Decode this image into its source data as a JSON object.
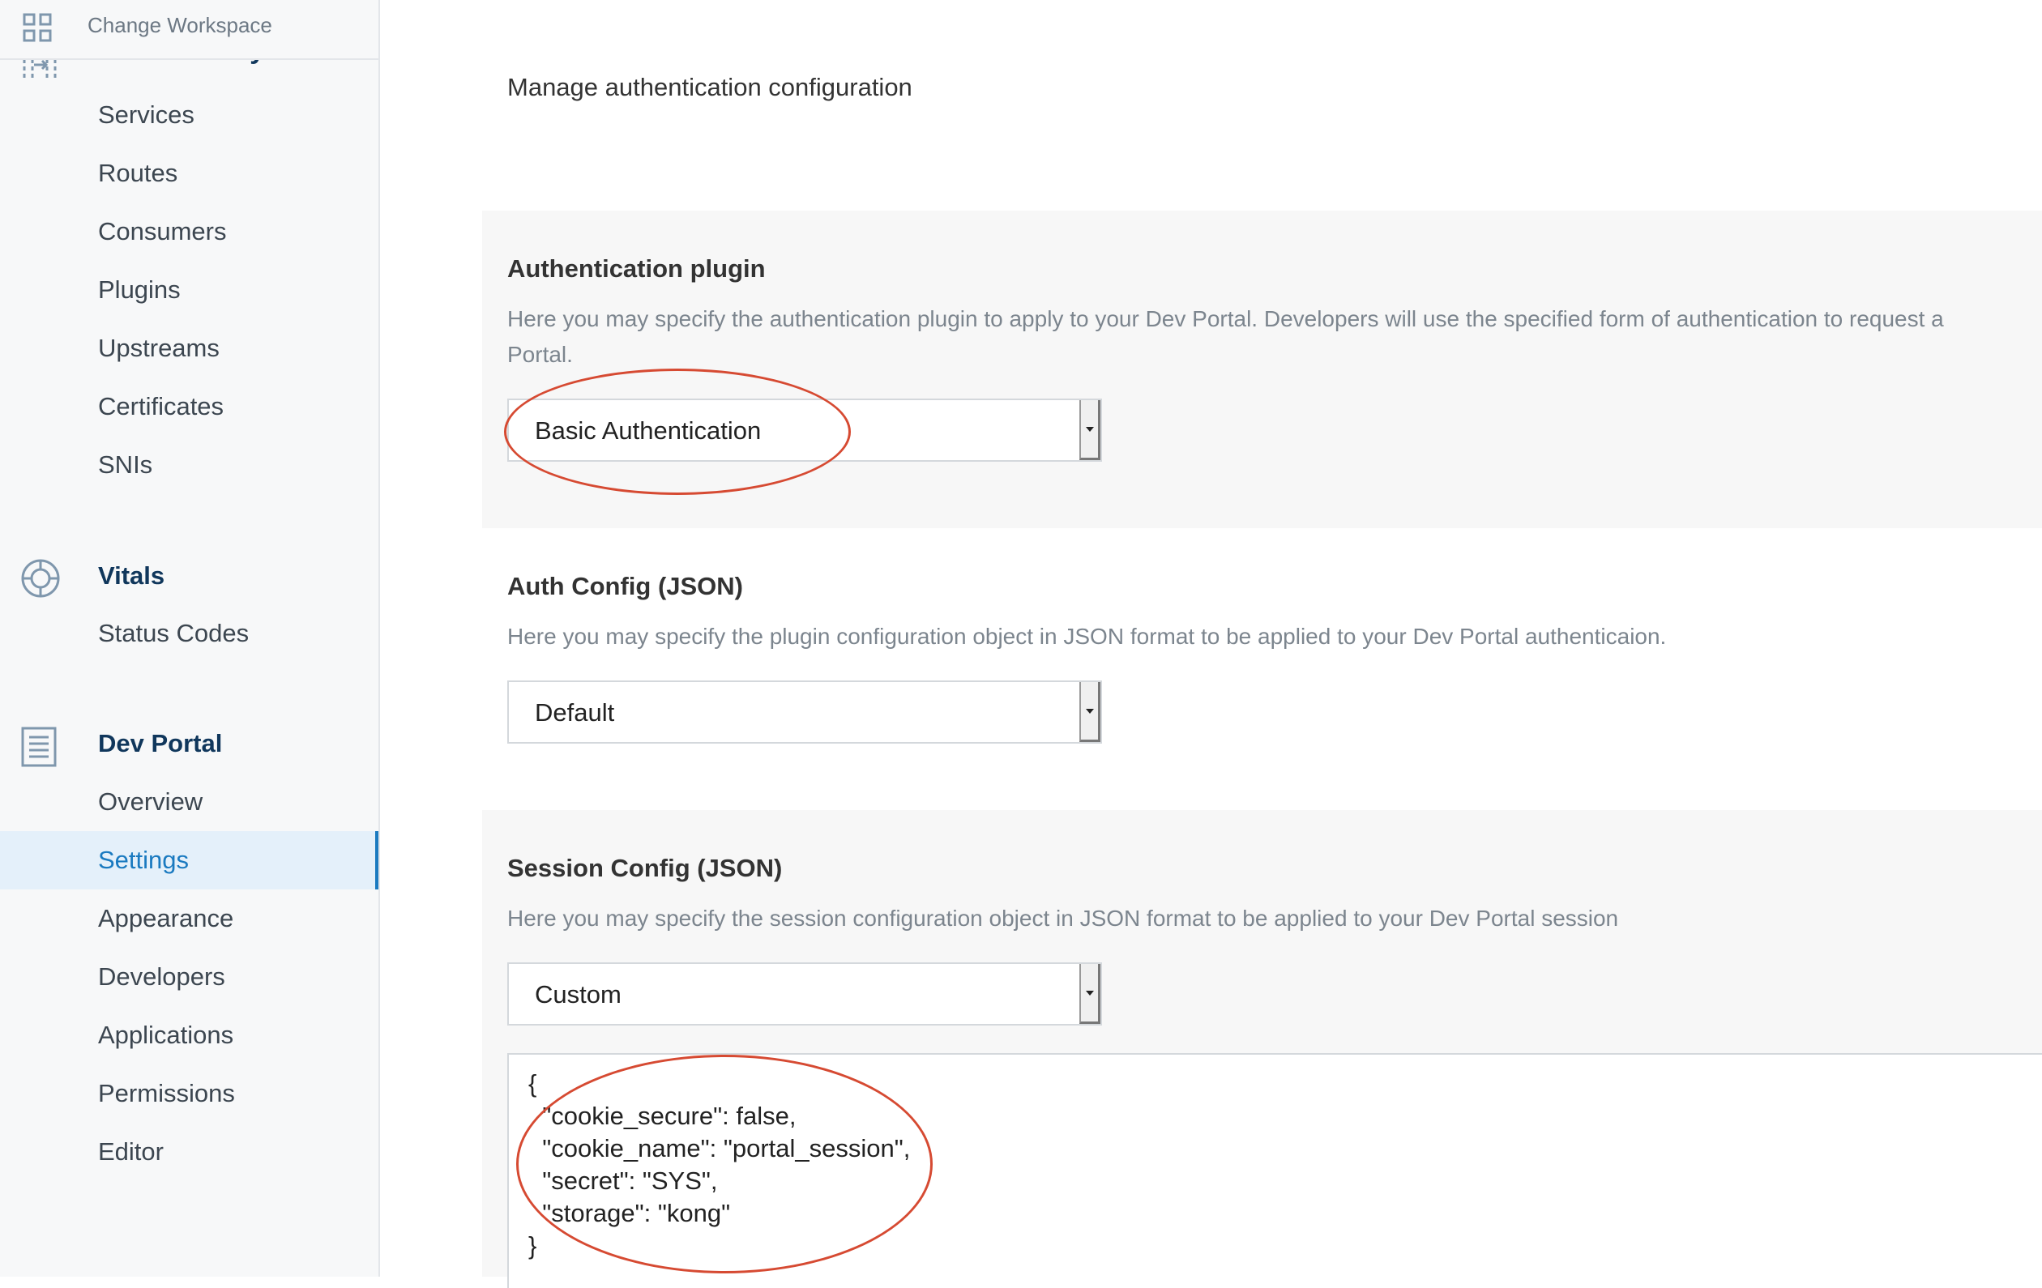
{
  "workspace": {
    "change_label": "Change Workspace"
  },
  "sidebar": {
    "api_gateway_heading": "API Gateway",
    "gateway_items": [
      {
        "label": "Services"
      },
      {
        "label": "Routes"
      },
      {
        "label": "Consumers"
      },
      {
        "label": "Plugins"
      },
      {
        "label": "Upstreams"
      },
      {
        "label": "Certificates"
      },
      {
        "label": "SNIs"
      }
    ],
    "vitals_heading": "Vitals",
    "vitals_items": [
      {
        "label": "Status Codes"
      }
    ],
    "devportal_heading": "Dev Portal",
    "devportal_items": [
      {
        "label": "Overview"
      },
      {
        "label": "Settings",
        "active": true
      },
      {
        "label": "Appearance"
      },
      {
        "label": "Developers"
      },
      {
        "label": "Applications"
      },
      {
        "label": "Permissions"
      },
      {
        "label": "Editor"
      }
    ]
  },
  "main": {
    "subtitle": "Manage authentication configuration",
    "auth_plugin": {
      "title": "Authentication plugin",
      "desc_line1": "Here you may specify the authentication plugin to apply to your Dev Portal. Developers will use the specified form of authentication to request a",
      "desc_line2": "Portal.",
      "selected": "Basic Authentication"
    },
    "auth_config": {
      "title": "Auth Config (JSON)",
      "desc": "Here you may specify the plugin configuration object in JSON format to be applied to your Dev Portal authenticaion.",
      "selected": "Default"
    },
    "session_config": {
      "title": "Session Config (JSON)",
      "desc": "Here you may specify the session configuration object in JSON format to be applied to your Dev Portal session",
      "selected": "Custom",
      "code_lines": [
        "{",
        "  \"cookie_secure\": false,",
        "  \"cookie_name\": \"portal_session\",",
        "  \"secret\": \"SYS\",",
        "  \"storage\": \"kong\"",
        "}"
      ]
    }
  },
  "colors": {
    "accent": "#1a7ac0",
    "heading": "#10375c",
    "annotation": "#d64a32"
  }
}
